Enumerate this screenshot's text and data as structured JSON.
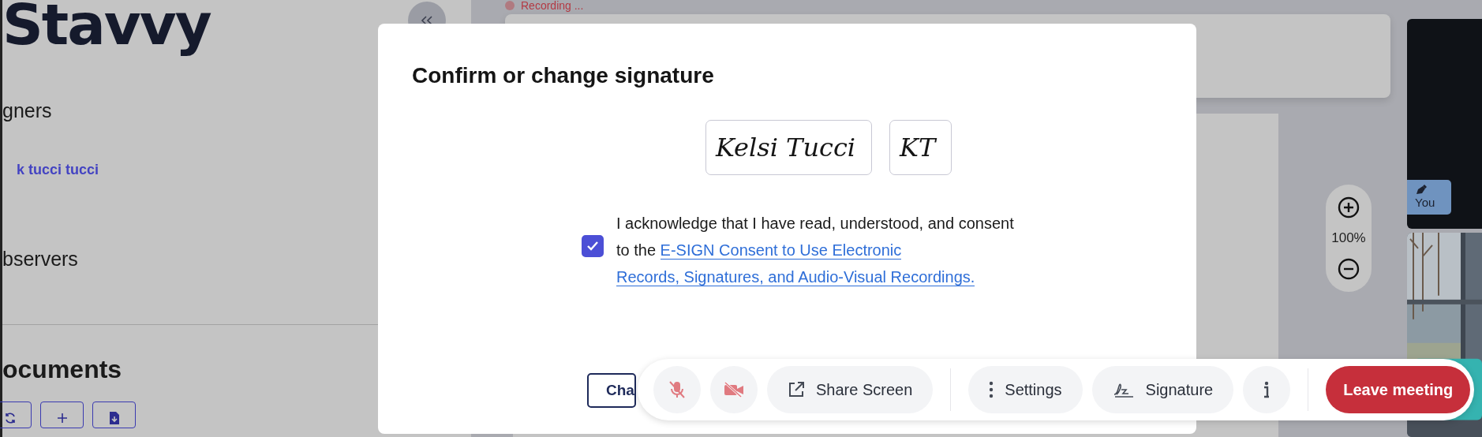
{
  "recording": {
    "label": "Recording ..."
  },
  "sidebar": {
    "logo": "Stavvy",
    "signers_heading": "gners",
    "signers": [
      {
        "name": "k tucci tucci"
      }
    ],
    "observers_heading": "bservers",
    "documents_heading": "ocuments",
    "document_actions": [
      {
        "kind": "refresh"
      },
      {
        "kind": "add"
      },
      {
        "kind": "download"
      }
    ]
  },
  "modal": {
    "title": "Confirm or change signature",
    "signatures": [
      {
        "text": "Kelsi Tucci"
      },
      {
        "text": "KT"
      }
    ],
    "consent": {
      "checked": true,
      "text": "I acknowledge that I have read, understood, and consent to the ",
      "link_lines": [
        "E-SIGN Consent to Use Electronic",
        "Records, Signatures, and Audio-Visual Recordings."
      ]
    },
    "button": "Cha"
  },
  "zoom": {
    "reading": "100%"
  },
  "videos": [
    {
      "kind": "camera-off",
      "label": "You"
    },
    {
      "kind": "picture"
    }
  ],
  "toolbar": [
    {
      "kind": "mic-off"
    },
    {
      "kind": "camera-off"
    },
    {
      "kind": "share",
      "label": "Share Screen"
    },
    {
      "kind": "settings",
      "label": "Settings",
      "group_start": true
    },
    {
      "kind": "signature",
      "label": "Signature"
    },
    {
      "kind": "info"
    },
    {
      "kind": "leave",
      "label": "Leave meeting",
      "group_start": true
    }
  ]
}
